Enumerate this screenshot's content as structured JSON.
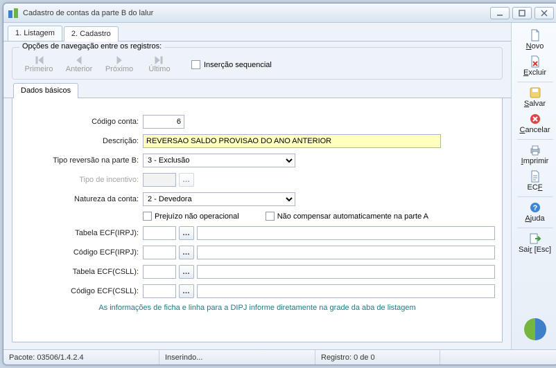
{
  "window": {
    "title": "Cadastro de contas da parte B do lalur"
  },
  "tabs_top": {
    "listagem": "1. Listagem",
    "cadastro": "2. Cadastro"
  },
  "nav": {
    "legend": "Opções de navegação entre os registros:",
    "primeiro": "Primeiro",
    "anterior": "Anterior",
    "proximo": "Próximo",
    "ultimo": "Último",
    "sequencial": "Inserção sequencial"
  },
  "inner_tab": {
    "dados": "Dados básicos"
  },
  "form": {
    "codigo_conta_label": "Código conta:",
    "codigo_conta_value": "6",
    "descricao_label": "Descrição:",
    "descricao_value": "REVERSAO SALDO PROVISAO DO ANO ANTERIOR",
    "tipo_reversao_label": "Tipo reversão na parte B:",
    "tipo_reversao_value": "3 - Exclusão",
    "tipo_incentivo_label": "Tipo de incentivo:",
    "tipo_incentivo_value": "",
    "natureza_label": "Natureza da conta:",
    "natureza_value": "2 - Devedora",
    "prejuizo_label": "Prejuízo não operacional",
    "nao_compensar_label": "Não compensar automaticamente na parte A",
    "tabela_ecf_irpj_label": "Tabela ECF(IRPJ):",
    "codigo_ecf_irpj_label": "Código ECF(IRPJ):",
    "tabela_ecf_csll_label": "Tabela ECF(CSLL):",
    "codigo_ecf_csll_label": "Código ECF(CSLL):",
    "hint": "As informações de ficha e linha para a DIPJ informe diretamente na grade da aba de listagem"
  },
  "right": {
    "novo": "Novo",
    "excluir": "Excluir",
    "salvar": "Salvar",
    "cancelar": "Cancelar",
    "imprimir": "Imprimir",
    "ecf": "ECF",
    "ajuda": "Ajuda",
    "sair": "Sair [Esc]"
  },
  "status": {
    "pacote": "Pacote: 03506/1.4.2.4",
    "modo": "Inserindo...",
    "registro": "Registro: 0 de 0"
  }
}
